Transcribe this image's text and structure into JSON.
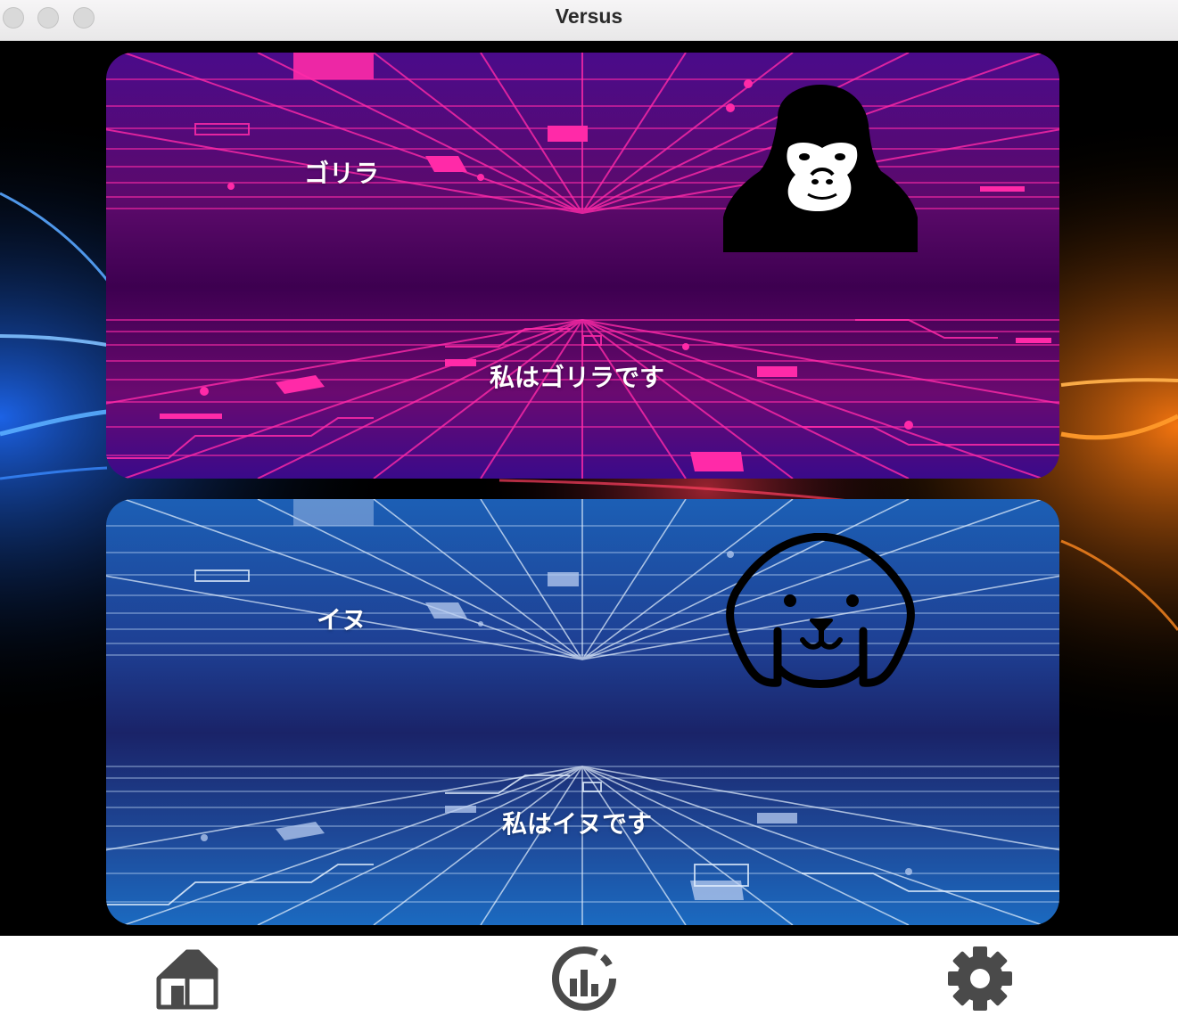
{
  "window": {
    "title": "Versus"
  },
  "cards": [
    {
      "name": "ゴリラ",
      "description": "私はゴリラです",
      "avatar_icon": "gorilla-icon",
      "theme": "magenta"
    },
    {
      "name": "イヌ",
      "description": "私はイヌです",
      "avatar_icon": "dog-icon",
      "theme": "blue"
    }
  ],
  "tabbar": {
    "items": [
      {
        "icon": "home-icon"
      },
      {
        "icon": "stats-chart-icon"
      },
      {
        "icon": "gear-icon"
      }
    ]
  },
  "colors": {
    "magenta_card_top": "#4a0b8a",
    "magenta_card_mid": "#3d0050",
    "magenta_neon": "#ff2aa8",
    "blue_card_top": "#1c5fb5",
    "blue_card_mid": "#1a2a6e",
    "blue_neon": "#cfe6ff",
    "icon_gray": "#4a4a4a"
  }
}
